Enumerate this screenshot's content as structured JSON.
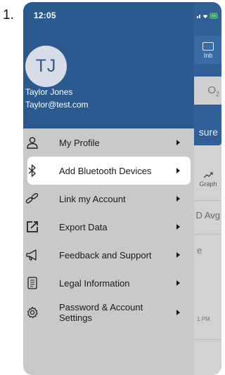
{
  "step_label": "1.",
  "status": {
    "time": "12:05"
  },
  "user": {
    "initials": "TJ",
    "name": "Taylor Jones",
    "email": "Taylor@test.com"
  },
  "menu": {
    "items": [
      {
        "label": "My Profile",
        "icon": "person-icon"
      },
      {
        "label": "Add Bluetooth Devices",
        "icon": "bluetooth-icon",
        "selected": true
      },
      {
        "label": "Link my Account",
        "icon": "link-icon"
      },
      {
        "label": "Export Data",
        "icon": "export-icon"
      },
      {
        "label": "Feedback and Support",
        "icon": "megaphone-icon"
      },
      {
        "label": "Legal Information",
        "icon": "document-icon"
      },
      {
        "label": "Password & Account Settings",
        "icon": "gear-icon"
      }
    ]
  },
  "background": {
    "inbox_label": "Inb",
    "o2_label": "O",
    "o2_sub": "2",
    "measure_partial": "sure",
    "graph_label": "Graph",
    "avg_partial": "D Avg",
    "e_partial": "e",
    "time_partial": "1 PM"
  },
  "colors": {
    "header": "#2a5a90",
    "drawer": "#c9c9c9",
    "selected": "#ffffff"
  }
}
